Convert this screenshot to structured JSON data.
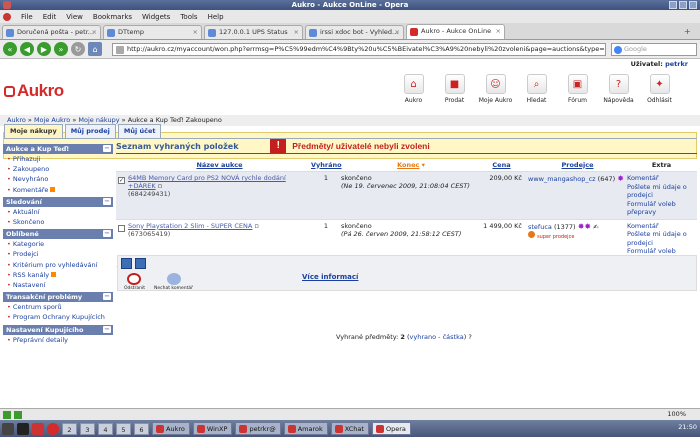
{
  "window": {
    "title": "Aukro - Aukce OnLine - Opera"
  },
  "menu": [
    "File",
    "Edit",
    "View",
    "Bookmarks",
    "Widgets",
    "Tools",
    "Help"
  ],
  "tabs": [
    "Doručená pošta - petr...",
    "DTtemp",
    "127.0.0.1 UPS Status",
    "irssi xdoc bot - Vyhled...",
    "Aukro - Aukce OnLine"
  ],
  "url": "http://aukro.cz/myaccount/won.php?errmsg=P%C5%99edm%C4%9Bty%20u%C5%BEivatel%C3%A9%20nebyli%20zvoleni&page=auctions&type=won",
  "search_placeholder": "Google",
  "user": {
    "label": "Uživatel",
    "name": "petrkr"
  },
  "logo": "Aukro",
  "topnav": [
    "Aukro",
    "Prodat",
    "Moje Aukro",
    "Hledat",
    "Fórum",
    "Nápověda",
    "Odhlásit"
  ],
  "breadcrumb": {
    "a": "Aukro",
    "b": "Moje Aukro",
    "c": "Moje nákupy",
    "d": "Aukce a Kup Teď! Zakoupeno"
  },
  "alert": "Předměty/ uživatelé nebyli zvoleni",
  "page_tabs": [
    "Moje nákupy",
    "Můj prodej",
    "Můj účet"
  ],
  "sidebar": {
    "s1": "Aukce a Kup Teď!",
    "s1items": [
      "Přihazuji",
      "Zakoupeno",
      "Nevyhráno",
      "Komentáře"
    ],
    "s2": "Sledování",
    "s2items": [
      "Aktuální",
      "Skončeno"
    ],
    "s3": "Oblíbené",
    "s3items": [
      "Kategorie",
      "Prodejci",
      "Kritérium pro vyhledávání",
      "RSS kanály",
      "Nastavení"
    ],
    "s4": "Transakční problémy",
    "s4items": [
      "Centrum sporů",
      "Program Ochrany Kupujících"
    ],
    "s5": "Nastavení Kupujícího",
    "s5items": [
      "Přeprávní detaily"
    ]
  },
  "main": {
    "title": "Seznam vyhraných položek",
    "cols": [
      "Název aukce",
      "Vyhráno",
      "Konec",
      "Cena",
      "Prodejce",
      "Extra"
    ],
    "rows": [
      {
        "title": "64MB Memory Card pro PS2 NOVÁ rychle dodání +DÁREK",
        "id": "(684249431)",
        "qty": "1",
        "status": "skončeno",
        "date": "(Ne 19. červenec 2009, 21:08:04 CEST)",
        "price": "209,00 Kč",
        "seller": "www_mangashop_cz",
        "rating": "(647)",
        "extra": [
          "Komentář",
          "Pošlete mi údaje o prodejci",
          "Formulář voleb přepravy"
        ]
      },
      {
        "title": "Sony Playstation 2 Slim - SUPER CENA",
        "id": "(673065419)",
        "qty": "1",
        "status": "skončeno",
        "date": "(Pá 26. červen 2009, 21:58:12 CEST)",
        "price": "1 499,00 Kč",
        "seller": "stefuca",
        "rating": "(1377)",
        "badge": "super prodejce",
        "extra": [
          "Komentář",
          "Pošlete mi údaje o prodejci",
          "Formulář voleb přepravy"
        ]
      }
    ],
    "btn_remove": "Odstranit",
    "btn_comment": "Nechat komentář",
    "more": "Více informací",
    "summary_label": "Vyhrané předměty:",
    "summary_count": "2",
    "summary_link": "vyhrano - částka"
  },
  "status": {
    "zoom": "100%"
  },
  "taskbar": {
    "workspaces": [
      "2",
      "3",
      "4",
      "5",
      "6"
    ],
    "tasks": [
      "Aukro",
      "WinXP",
      "petrkr@",
      "Amarok",
      "XChat",
      "Opera"
    ],
    "clock": "21:50"
  }
}
